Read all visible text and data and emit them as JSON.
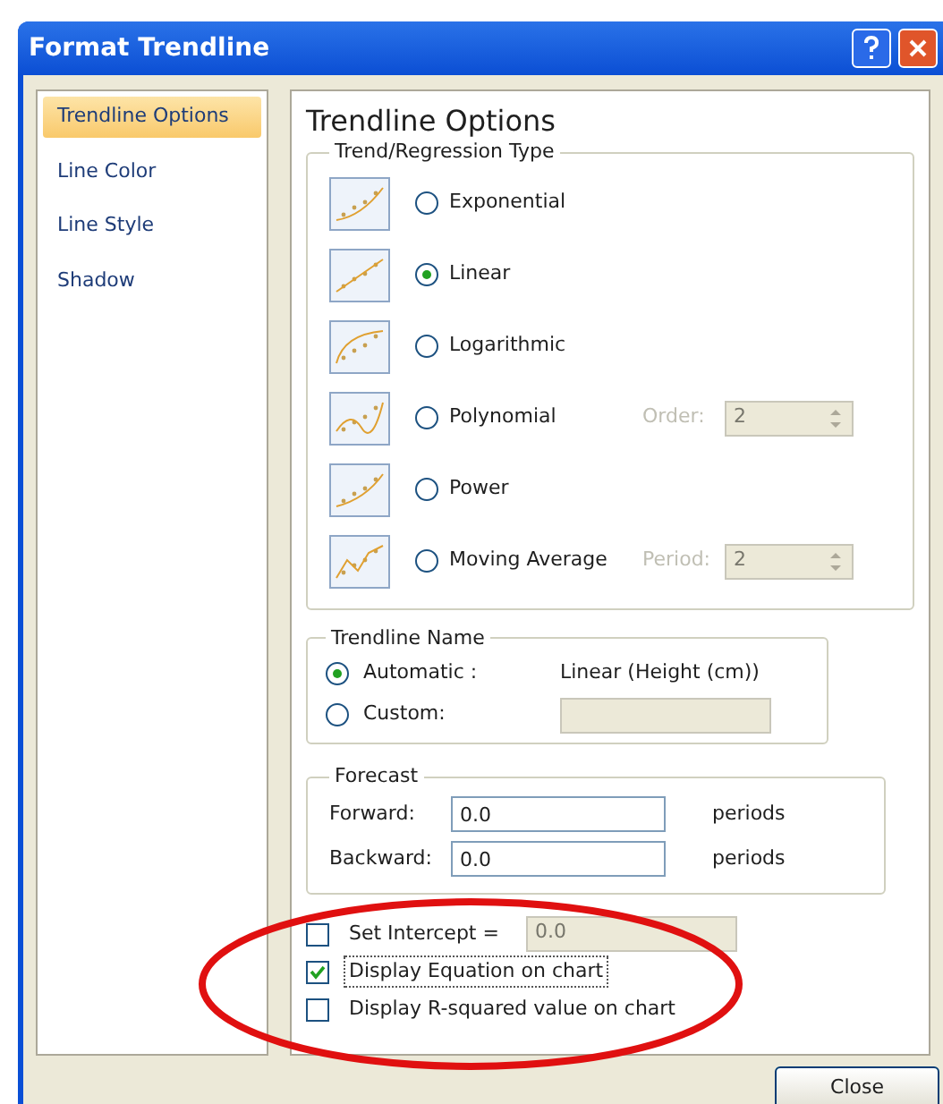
{
  "window": {
    "title": "Format Trendline"
  },
  "sidebar": {
    "items": [
      {
        "label": "Trendline Options",
        "selected": true
      },
      {
        "label": "Line Color",
        "selected": false
      },
      {
        "label": "Line Style",
        "selected": false
      },
      {
        "label": "Shadow",
        "selected": false
      }
    ]
  },
  "panel": {
    "title": "Trendline Options",
    "trend_type": {
      "legend": "Trend/Regression Type",
      "options": [
        {
          "label": "Exponential",
          "selected": false
        },
        {
          "label": "Linear",
          "selected": true
        },
        {
          "label": "Logarithmic",
          "selected": false
        },
        {
          "label": "Polynomial",
          "selected": false,
          "param": {
            "label": "Order:",
            "value": "2",
            "disabled": true
          }
        },
        {
          "label": "Power",
          "selected": false
        },
        {
          "label": "Moving Average",
          "selected": false,
          "param": {
            "label": "Period:",
            "value": "2",
            "disabled": true
          }
        }
      ]
    },
    "trendline_name": {
      "legend": "Trendline Name",
      "options": [
        {
          "label": "Automatic :",
          "selected": true,
          "value": "Linear (Height (cm))"
        },
        {
          "label": "Custom:",
          "selected": false
        }
      ]
    },
    "forecast": {
      "legend": "Forecast",
      "fields": [
        {
          "label": "Forward:",
          "value": "0.0",
          "unit": "periods"
        },
        {
          "label": "Backward:",
          "value": "0.0",
          "unit": "periods"
        }
      ]
    },
    "checkboxes": [
      {
        "label": "Set Intercept =",
        "checked": false,
        "value": "0.0",
        "disabled": true
      },
      {
        "label": "Display Equation on chart",
        "checked": true
      },
      {
        "label": "Display R-squared value on chart",
        "checked": false
      }
    ]
  },
  "buttons": [
    "Close"
  ]
}
